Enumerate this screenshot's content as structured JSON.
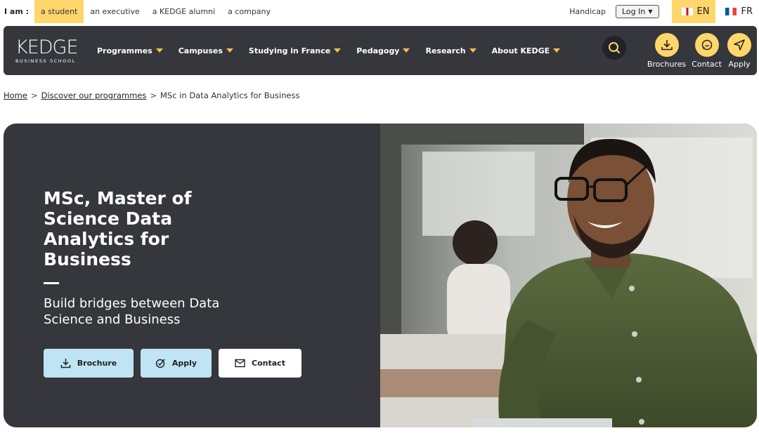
{
  "topbar": {
    "iam_label": "I am :",
    "audiences": [
      "a student",
      "an executive",
      "a KEDGE alumni",
      "a company"
    ],
    "handicap": "Handicap",
    "login": "Log In",
    "languages": [
      {
        "code": "EN",
        "flag": "uk-flag-icon",
        "active": true
      },
      {
        "code": "FR",
        "flag": "fr-flag-icon",
        "active": false
      }
    ]
  },
  "nav": {
    "logo_main": "KEDGE",
    "logo_sub": "BUSINESS SCHOOL",
    "menu": [
      "Programmes",
      "Campuses",
      "Studying in France",
      "Pedagogy",
      "Research",
      "About KEDGE"
    ],
    "actions": [
      {
        "label": "Brochures",
        "icon": "download-icon"
      },
      {
        "label": "Contact",
        "icon": "chat-icon"
      },
      {
        "label": "Apply",
        "icon": "send-icon"
      }
    ]
  },
  "breadcrumb": {
    "home": "Home",
    "sep": ">",
    "programmes": "Discover our programmes",
    "current": "MSc in Data Analytics for Business"
  },
  "hero": {
    "title": "MSc, Master of Science Data Analytics for Business",
    "subtitle": "Build bridges between Data Science and Business",
    "buttons": {
      "brochure": "Brochure",
      "apply": "Apply",
      "contact": "Contact"
    }
  },
  "colors": {
    "accent_yellow": "#fed66b",
    "dark_panel": "#36373d",
    "light_blue": "#bfe4f3"
  }
}
